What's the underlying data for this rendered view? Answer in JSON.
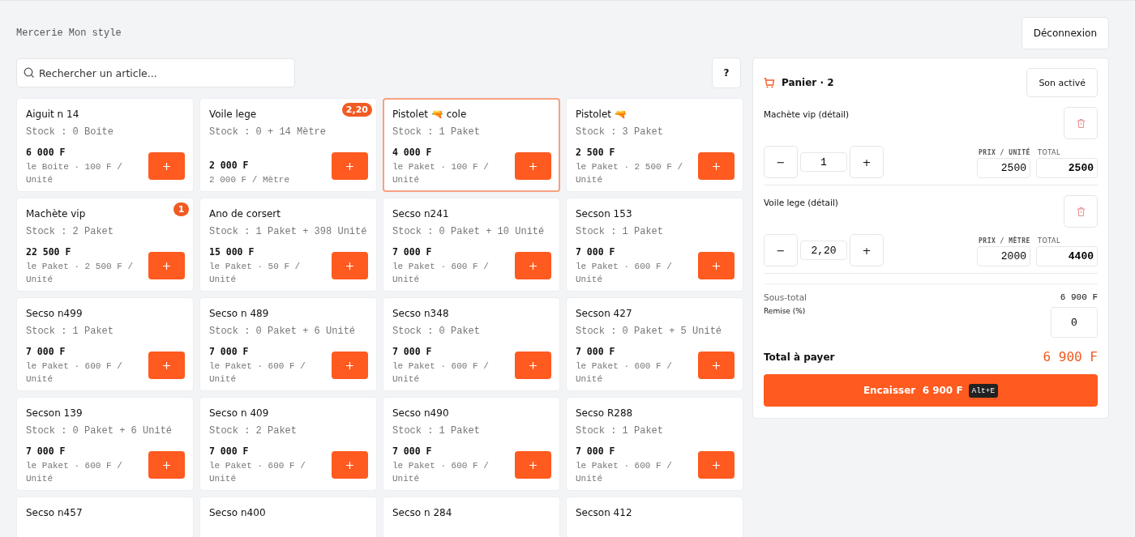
{
  "header": {
    "title": "Mercerie Mon style",
    "logout": "Déconnexion"
  },
  "search": {
    "placeholder": "Rechercher un article..."
  },
  "help": "?",
  "products": [
    {
      "name": "Aiguit n 14",
      "stock": "Stock : 0 Boite",
      "price": "6 000 F",
      "unit": "le Boite · 100 F / Unité",
      "selected": false
    },
    {
      "name": "Voile lege",
      "stock": "Stock : 0 + 14 Mètre",
      "price": "2 000 F",
      "unit": "2 000 F / Mètre",
      "badge": "2,20",
      "selected": false
    },
    {
      "name": "Pistolet 🔫 cole",
      "stock": "Stock : 1 Paket",
      "price": "4 000 F",
      "unit": "le Paket · 100 F / Unité",
      "selected": true
    },
    {
      "name": "Pistolet 🔫",
      "stock": "Stock : 3 Paket",
      "price": "2 500 F",
      "unit": "le Paket · 2 500 F / Unité",
      "selected": false
    },
    {
      "name": "Machète vip",
      "stock": "Stock : 2 Paket",
      "price": "22 500 F",
      "unit": "le Paket · 2 500 F / Unité",
      "badge": "1",
      "selected": false
    },
    {
      "name": "Ano de corsert",
      "stock": "Stock : 1 Paket + 398 Unité",
      "price": "15 000 F",
      "unit": "le Paket · 50 F / Unité",
      "selected": false
    },
    {
      "name": "Secso n241",
      "stock": "Stock : 0 Paket + 10 Unité",
      "price": "7 000 F",
      "unit": "le Paket · 600 F / Unité",
      "selected": false
    },
    {
      "name": "Secson 153",
      "stock": "Stock : 1 Paket",
      "price": "7 000 F",
      "unit": "le Paket · 600 F / Unité",
      "selected": false
    },
    {
      "name": "Secso n499",
      "stock": "Stock : 1 Paket",
      "price": "7 000 F",
      "unit": "le Paket · 600 F / Unité",
      "selected": false
    },
    {
      "name": "Secso n 489",
      "stock": "Stock : 0 Paket + 6 Unité",
      "price": "7 000 F",
      "unit": "le Paket · 600 F / Unité",
      "selected": false
    },
    {
      "name": "Secso n348",
      "stock": "Stock : 0 Paket",
      "price": "7 000 F",
      "unit": "le Paket · 600 F / Unité",
      "selected": false
    },
    {
      "name": "Secson 427",
      "stock": "Stock : 0 Paket + 5 Unité",
      "price": "7 000 F",
      "unit": "le Paket · 600 F / Unité",
      "selected": false
    },
    {
      "name": "Secson 139",
      "stock": "Stock : 0 Paket + 6 Unité",
      "price": "7 000 F",
      "unit": "le Paket · 600 F / Unité",
      "selected": false
    },
    {
      "name": "Secso n 409",
      "stock": "Stock : 2 Paket",
      "price": "7 000 F",
      "unit": "le Paket · 600 F / Unité",
      "selected": false
    },
    {
      "name": "Secso n490",
      "stock": "Stock : 1 Paket",
      "price": "7 000 F",
      "unit": "le Paket · 600 F / Unité",
      "selected": false
    },
    {
      "name": "Secso R288",
      "stock": "Stock : 1 Paket",
      "price": "7 000 F",
      "unit": "le Paket · 600 F / Unité",
      "selected": false
    },
    {
      "name": "Secso n457",
      "selected": false
    },
    {
      "name": "Secso n400",
      "selected": false
    },
    {
      "name": "Secso n 284",
      "selected": false
    },
    {
      "name": "Secson 412",
      "selected": false
    }
  ],
  "cart": {
    "title": "Panier · 2",
    "sound": "Son activé",
    "minus": "−",
    "plus": "+",
    "items": [
      {
        "name": "Machète vip (détail)",
        "qty": "1",
        "price_label": "PRIX / UNITÉ",
        "price": "2500",
        "total_label": "TOTAL",
        "total": "2500"
      },
      {
        "name": "Voile lege (détail)",
        "qty": "2,20",
        "price_label": "PRIX / MÈTRE",
        "price": "2000",
        "total_label": "TOTAL",
        "total": "4400"
      }
    ],
    "subtotal_label": "Sous-total",
    "subtotal": "6 900 F",
    "discount_label": "Remise (%)",
    "discount": "0",
    "total_label": "Total à payer",
    "total": "6 900 F",
    "checkout": "Encaisser  6 900 F",
    "shortcut": "Alt+E"
  }
}
